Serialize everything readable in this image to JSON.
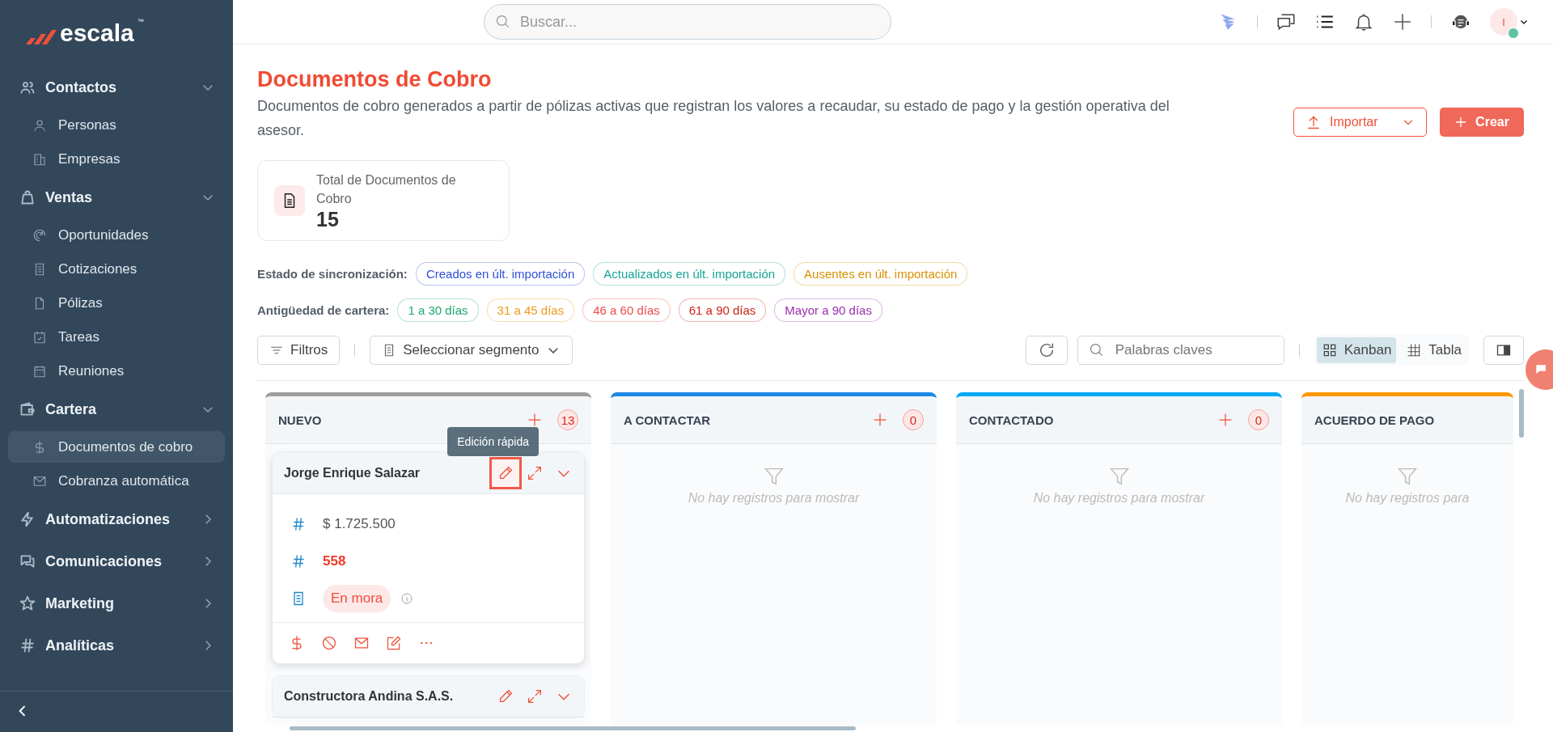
{
  "sidebar": {
    "logo": {
      "text": "escala",
      "mark": "™"
    },
    "sections": [
      {
        "label": "Contactos",
        "expanded": true,
        "children": [
          {
            "label": "Personas",
            "selected": false
          },
          {
            "label": "Empresas",
            "selected": false
          }
        ]
      },
      {
        "label": "Ventas",
        "expanded": true,
        "children": [
          {
            "label": "Oportunidades",
            "selected": false
          },
          {
            "label": "Cotizaciones",
            "selected": false
          },
          {
            "label": "Pólizas",
            "selected": false
          },
          {
            "label": "Tareas",
            "selected": false
          },
          {
            "label": "Reuniones",
            "selected": false
          }
        ]
      },
      {
        "label": "Cartera",
        "expanded": true,
        "children": [
          {
            "label": "Documentos de cobro",
            "selected": true
          },
          {
            "label": "Cobranza automática",
            "selected": false
          }
        ]
      },
      {
        "label": "Automatizaciones",
        "expanded": false
      },
      {
        "label": "Comunicaciones",
        "expanded": false
      },
      {
        "label": "Marketing",
        "expanded": false
      },
      {
        "label": "Analíticas",
        "expanded": false
      }
    ]
  },
  "topbar": {
    "search": {
      "placeholder": "Buscar..."
    },
    "avatar": {
      "initial": "I",
      "online": true
    }
  },
  "header": {
    "title": "Documentos de Cobro",
    "description": "Documentos de cobro generados a partir de pólizas activas que registran los valores a recaudar, su estado de pago y la gestión operativa del asesor.",
    "import_button": "Importar",
    "create_button": "Crear"
  },
  "summary": {
    "label": "Total de Documentos de Cobro",
    "value": "15"
  },
  "filters": [
    {
      "label": "Estado de sincronización:",
      "chips": [
        {
          "label": "Creados en últ. importación",
          "color": "#2f4fd8"
        },
        {
          "label": "Actualizados en últ. importación",
          "color": "#16a394"
        },
        {
          "label": "Ausentes en últ. importación",
          "color": "#d99000"
        }
      ]
    },
    {
      "label": "Antigüedad de cartera:",
      "chips": [
        {
          "label": "1 a 30 días",
          "color": "#1aa86e"
        },
        {
          "label": "31 a 45 días",
          "color": "#ee9a1a"
        },
        {
          "label": "46 a 60 días",
          "color": "#ef4a4a"
        },
        {
          "label": "61 a 90 días",
          "color": "#cc2316"
        },
        {
          "label": "Mayor a 90 días",
          "color": "#9b2fae"
        }
      ]
    }
  ],
  "toolbar": {
    "filters_button": "Filtros",
    "segment_select": "Seleccionar segmento",
    "keyword_search": {
      "placeholder": "Palabras claves"
    },
    "views": [
      {
        "label": "Kanban",
        "selected": true
      },
      {
        "label": "Tabla",
        "selected": false
      }
    ]
  },
  "columns": [
    {
      "title": "NUEVO",
      "color": "#9e9e9e",
      "count": "13",
      "cards": [
        {
          "title": "Jorge Enrique Salazar",
          "tooltip": "Edición rápida",
          "fields": [
            {
              "kind": "amount",
              "value": "$ 1.725.500"
            },
            {
              "kind": "number",
              "value": "558"
            },
            {
              "kind": "status",
              "value": "En mora"
            }
          ]
        },
        {
          "title": "Constructora Andina S.A.S."
        }
      ]
    },
    {
      "title": "A CONTACTAR",
      "color": "#1e88e5",
      "count": "0",
      "empty_text": "No hay registros para mostrar"
    },
    {
      "title": "CONTACTADO",
      "color": "#03a9f4",
      "count": "0",
      "empty_text": "No hay registros para mostrar"
    },
    {
      "title": "ACUERDO DE PAGO",
      "color": "#ff9800",
      "empty_text": "No hay registros para"
    }
  ]
}
